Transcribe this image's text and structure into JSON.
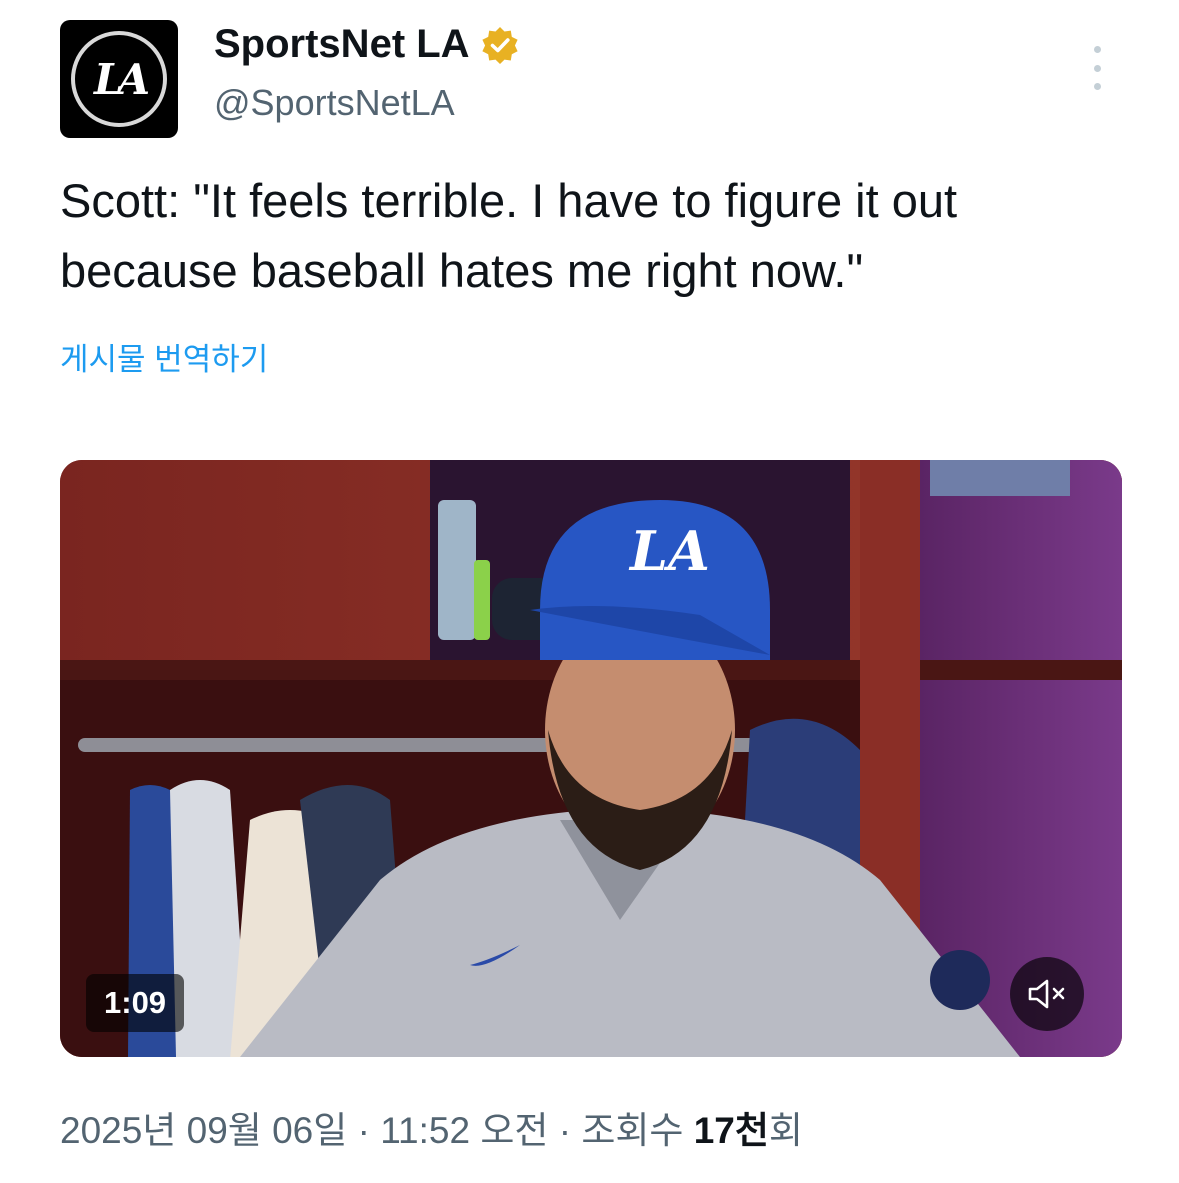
{
  "author": {
    "display_name": "SportsNet LA",
    "handle": "@SportsNetLA",
    "avatar_text": "LA",
    "verified_icon": "verified-badge-gold",
    "verified_color": "#e8b123"
  },
  "tweet": {
    "text": "Scott: \"It feels terrible. I have to figure it out because baseball hates me right now.\"",
    "translate_label": "게시물 번역하기"
  },
  "media": {
    "duration": "1:09",
    "mute_icon": "muted-speaker-icon",
    "cap_logo": "LA"
  },
  "meta": {
    "date": "2025년 09월 06일",
    "separator": " · ",
    "time": "11:52 오전",
    "views_label": "조회수 ",
    "views_count": "17천",
    "views_suffix": "회"
  },
  "colors": {
    "link": "#1d9bf0",
    "secondary_text": "#536471",
    "primary_text": "#0f1419"
  }
}
